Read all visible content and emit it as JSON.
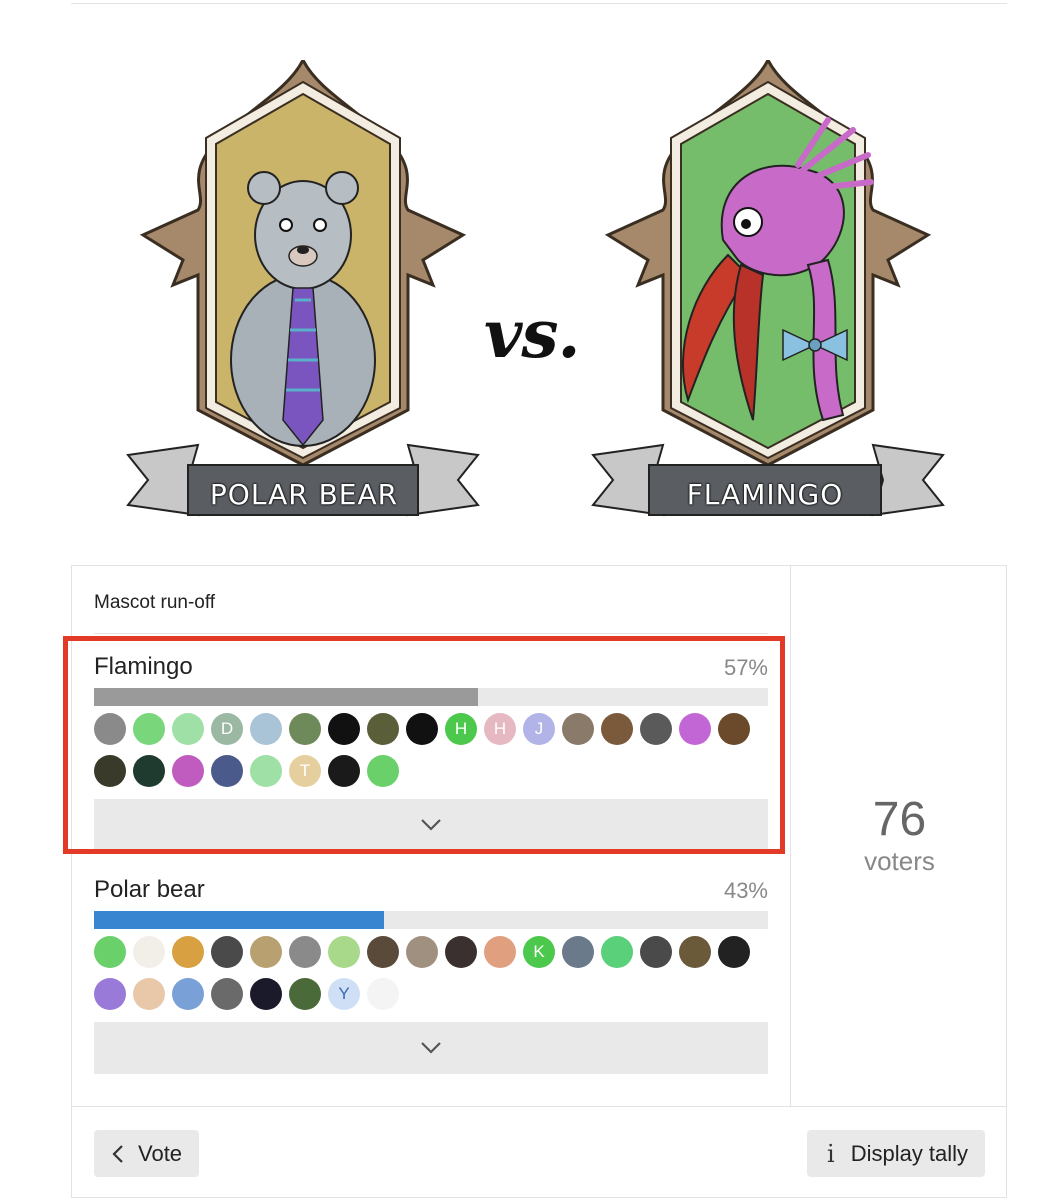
{
  "banner": {
    "left_crest_label": "POLAR BEAR",
    "right_crest_label": "FLAMINGO",
    "versus_text": "vs.",
    "left_panel_color": "#c9b46a",
    "right_panel_color": "#76bd6b"
  },
  "poll": {
    "title": "Mascot run-off",
    "options": [
      {
        "name": "Flamingo",
        "percent_label": "57%",
        "percent": 57,
        "bar_color": "#9a9a9a",
        "highlighted": true,
        "voter_avatars": [
          {
            "label": "",
            "color": "#8a8a8a"
          },
          {
            "label": "",
            "color": "#7ad67a"
          },
          {
            "label": "",
            "color": "#9ee0a5"
          },
          {
            "label": "D",
            "color": "#9bb8a3"
          },
          {
            "label": "",
            "color": "#a9c4d6"
          },
          {
            "label": "",
            "color": "#6f8a5a"
          },
          {
            "label": "",
            "color": "#111111"
          },
          {
            "label": "",
            "color": "#5a5f3a"
          },
          {
            "label": "",
            "color": "#111111"
          },
          {
            "label": "H",
            "color": "#4cc94c"
          },
          {
            "label": "H",
            "color": "#e6b8c2"
          },
          {
            "label": "J",
            "color": "#b2b3e6"
          },
          {
            "label": "",
            "color": "#8a7a6a"
          },
          {
            "label": "",
            "color": "#7a5a3a"
          },
          {
            "label": "",
            "color": "#5a5a5a"
          },
          {
            "label": "",
            "color": "#c266d6"
          },
          {
            "label": "",
            "color": "#6a4a2a"
          },
          {
            "label": "",
            "color": "#3a3a2a"
          },
          {
            "label": "",
            "color": "#1f3a2f"
          },
          {
            "label": "",
            "color": "#c05cc0"
          },
          {
            "label": "",
            "color": "#4a5a8a"
          },
          {
            "label": "",
            "color": "#9ee0a5"
          },
          {
            "label": "T",
            "color": "#e6cf9f"
          },
          {
            "label": "",
            "color": "#1a1a1a"
          },
          {
            "label": "",
            "color": "#6ad06a"
          }
        ],
        "expand_icon": "chevron-down-icon"
      },
      {
        "name": "Polar bear",
        "percent_label": "43%",
        "percent": 43,
        "bar_color": "#3a85d0",
        "highlighted": false,
        "voter_avatars": [
          {
            "label": "",
            "color": "#6ad06a"
          },
          {
            "label": "",
            "color": "#f1efe8"
          },
          {
            "label": "",
            "color": "#d8a040"
          },
          {
            "label": "",
            "color": "#4a4a4a"
          },
          {
            "label": "",
            "color": "#b8a070"
          },
          {
            "label": "",
            "color": "#8a8a8a"
          },
          {
            "label": "",
            "color": "#a8d88a"
          },
          {
            "label": "",
            "color": "#5a4a3a"
          },
          {
            "label": "",
            "color": "#a09080"
          },
          {
            "label": "",
            "color": "#3a3030"
          },
          {
            "label": "",
            "color": "#e0a080"
          },
          {
            "label": "K",
            "color": "#4cc94c"
          },
          {
            "label": "",
            "color": "#6a7a8a"
          },
          {
            "label": "",
            "color": "#5ad07a"
          },
          {
            "label": "",
            "color": "#4a4a4a"
          },
          {
            "label": "",
            "color": "#6a5a3a"
          },
          {
            "label": "",
            "color": "#222222"
          },
          {
            "label": "",
            "color": "#9a7ad8"
          },
          {
            "label": "",
            "color": "#e8c8a8"
          },
          {
            "label": "",
            "color": "#7aa0d8"
          },
          {
            "label": "",
            "color": "#6a6a6a"
          },
          {
            "label": "",
            "color": "#1a1a2a"
          },
          {
            "label": "",
            "color": "#4a6a3a"
          },
          {
            "label": "Y",
            "color": "#cfe0f6"
          },
          {
            "label": "",
            "color": "#f4f4f4"
          }
        ],
        "expand_icon": "chevron-down-icon"
      }
    ],
    "voters_count": "76",
    "voters_label": "voters",
    "footer": {
      "vote_button": "Vote",
      "vote_icon": "chevron-left-icon",
      "tally_button": "Display tally",
      "tally_icon": "info-icon"
    }
  }
}
